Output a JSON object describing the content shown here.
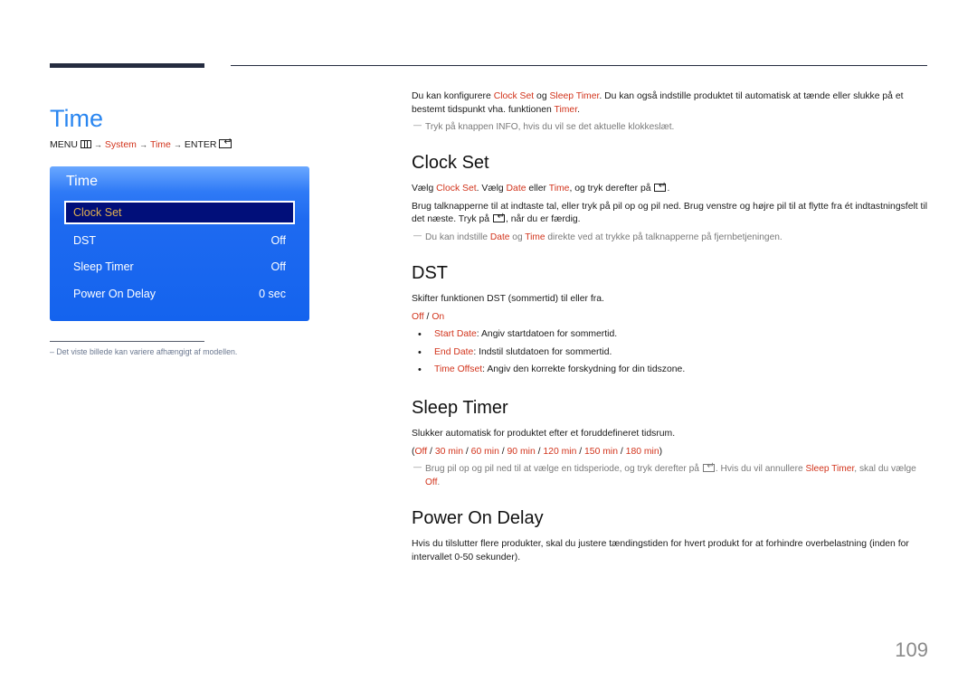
{
  "page": {
    "title": "Time",
    "page_number": "109",
    "breadcrumb": {
      "menu": "MENU",
      "menu_icon": "menu-grid-icon",
      "system": "System",
      "time": "Time",
      "enter": "ENTER",
      "enter_icon": "enter-icon",
      "arrow": "→"
    }
  },
  "osd": {
    "title": "Time",
    "items": [
      {
        "label": "Clock Set",
        "value": "",
        "selected": true
      },
      {
        "label": "DST",
        "value": "Off"
      },
      {
        "label": "Sleep Timer",
        "value": "Off"
      },
      {
        "label": "Power On Delay",
        "value": "0 sec"
      }
    ],
    "footnote": "–  Det viste billede kan variere afhængigt af modellen."
  },
  "intro": {
    "p1_a": "Du kan konfigurere ",
    "p1_clock": "Clock Set",
    "p1_b": " og ",
    "p1_sleep": "Sleep Timer",
    "p1_c": ". Du kan også indstille produktet til automatisk at tænde eller slukke på et bestemt tidspunkt vha. funktionen ",
    "p1_timer": "Timer",
    "p1_d": ".",
    "note": "Tryk på knappen INFO, hvis du vil se det aktuelle klokkeslæt."
  },
  "clock_set": {
    "heading": "Clock Set",
    "p1_a": "Vælg ",
    "p1_clock": "Clock Set",
    "p1_b": ". Vælg ",
    "p1_date": "Date",
    "p1_c": " eller ",
    "p1_time": "Time",
    "p1_d": ", og tryk derefter på ",
    "p1_e": ".",
    "p2_a": "Brug talknapperne til at indtaste tal, eller tryk på pil op og pil ned. Brug venstre og højre pil til at flytte fra ét indtastningsfelt til det næste. Tryk på ",
    "p2_b": ", når du er færdig.",
    "note_a": "Du kan indstille ",
    "note_date": "Date",
    "note_b": " og ",
    "note_time": "Time",
    "note_c": " direkte ved at trykke på talknapperne på fjernbetjeningen."
  },
  "dst": {
    "heading": "DST",
    "p1": "Skifter funktionen DST (sommertid) til eller fra.",
    "opt_off": "Off",
    "opt_sep": " / ",
    "opt_on": "On",
    "bullets": [
      {
        "term": "Start Date",
        "text": ": Angiv startdatoen for sommertid."
      },
      {
        "term": "End Date",
        "text": ": Indstil slutdatoen for sommertid."
      },
      {
        "term": "Time Offset",
        "text": ": Angiv den korrekte forskydning for din tidszone."
      }
    ]
  },
  "sleep_timer": {
    "heading": "Sleep Timer",
    "p1": "Slukker automatisk for produktet efter et foruddefineret tidsrum.",
    "options": [
      "Off",
      "30 min",
      "60 min",
      "90 min",
      "120 min",
      "150 min",
      "180 min"
    ],
    "note_a": "Brug pil op og pil ned til at vælge en tidsperiode, og tryk derefter på ",
    "note_b": ". Hvis du vil annullere ",
    "note_sleep": "Sleep Timer",
    "note_c": ", skal du vælge ",
    "note_off": "Off",
    "note_d": "."
  },
  "power_on_delay": {
    "heading": "Power On Delay",
    "p1": "Hvis du tilslutter flere produkter, skal du justere tændingstiden for hvert produkt for at forhindre overbelastning (inden for intervallet 0-50 sekunder)."
  },
  "colors": {
    "title_blue": "#2a86f0",
    "highlight_red": "#d2341c",
    "osd_blue": "#1463ee",
    "osd_selected_bg": "#010f7a",
    "osd_selected_text": "#e0b050",
    "rule_dark": "#252c40"
  }
}
